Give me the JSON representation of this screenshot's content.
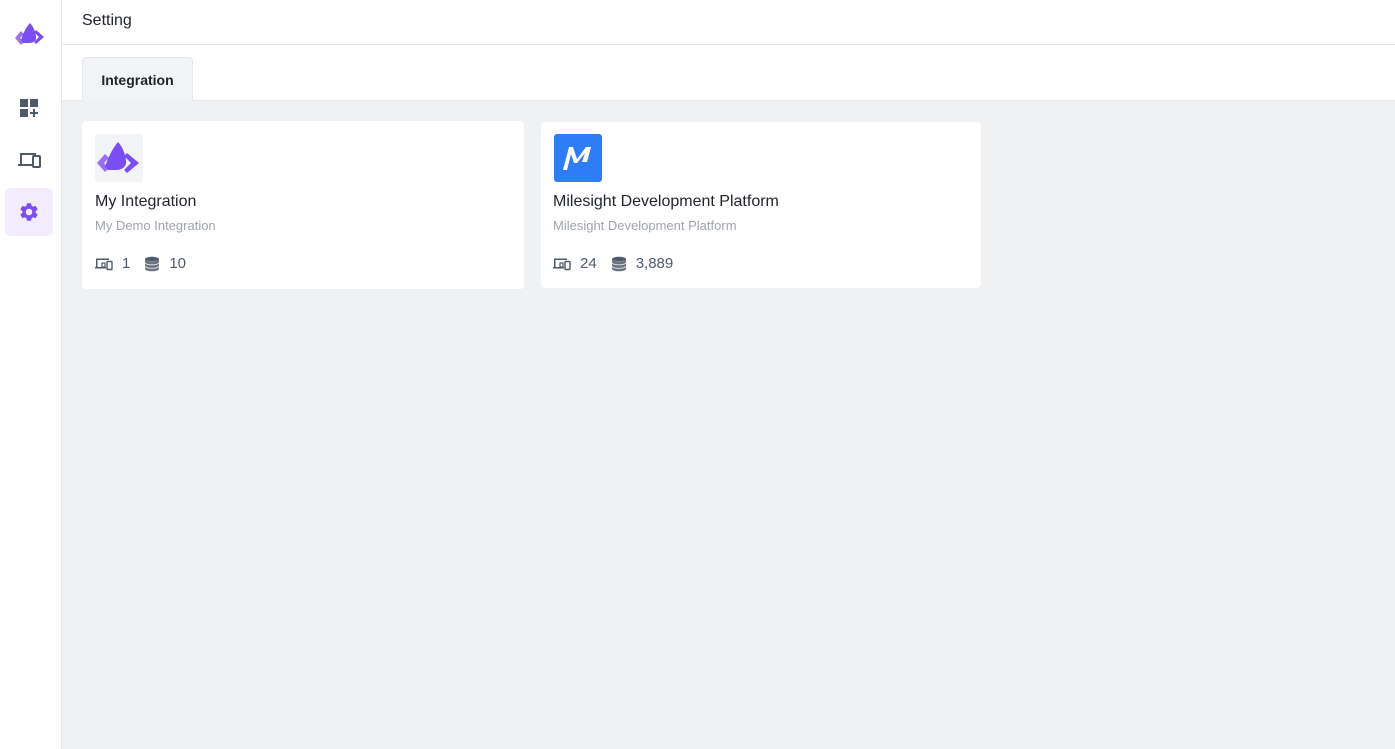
{
  "header": {
    "title": "Setting"
  },
  "sidebar": {
    "logo_icon": "brand-logo-icon",
    "items": [
      {
        "name": "dashboard",
        "icon": "dashboard-add-icon",
        "active": false
      },
      {
        "name": "devices",
        "icon": "devices-icon",
        "active": false
      },
      {
        "name": "setting",
        "icon": "gear-icon",
        "active": true
      }
    ],
    "accent_color": "#7b4ef3"
  },
  "tabs": [
    {
      "label": "Integration",
      "active": true
    }
  ],
  "integrations": [
    {
      "name": "My Integration",
      "description": "My Demo Integration",
      "logo": "brand-logo-icon",
      "device_count": "1",
      "entity_count": "10"
    },
    {
      "name": "Milesight Development Platform",
      "description": "Milesight Development Platform",
      "logo": "milesight-m-icon",
      "logo_color": "#2f7df6",
      "device_count": "24",
      "entity_count": "3,889"
    }
  ]
}
